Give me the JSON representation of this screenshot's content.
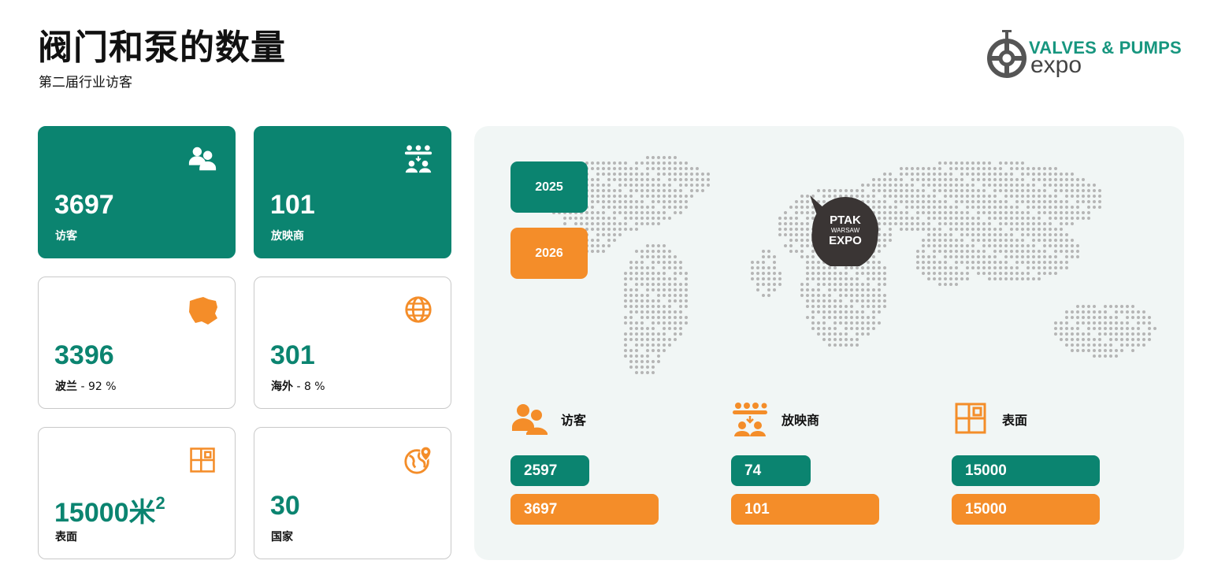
{
  "header": {
    "title": "阀门和泵的数量",
    "subtitle": "第二届行业访客"
  },
  "logo": {
    "line1": "VALVES & PUMPS",
    "line2": "expo"
  },
  "cards": [
    {
      "value": "3697",
      "label": "访客",
      "icon": "visitors-icon"
    },
    {
      "value": "101",
      "label": "放映商",
      "icon": "exhibitors-icon"
    },
    {
      "value": "3396",
      "label": "波兰",
      "label_rest": " - 92 %",
      "icon": "poland-map-icon"
    },
    {
      "value": "301",
      "label": "海外",
      "label_rest": " - 8 %",
      "icon": "globe-icon"
    },
    {
      "value": "15000米",
      "value_sup": "2",
      "label": "表面",
      "icon": "floor-plan-icon"
    },
    {
      "value": "30",
      "label": "国家",
      "icon": "globe-pin-icon"
    }
  ],
  "map_panel": {
    "year_2025": "2025",
    "year_2026": "2026",
    "pin_line1": "PTAK",
    "pin_line2": "WARSAW",
    "pin_line3": "EXPO"
  },
  "comparison": [
    {
      "label": "访客",
      "value_2025": "2597",
      "value_2026": "3697",
      "icon": "visitors-icon"
    },
    {
      "label": "放映商",
      "value_2025": "74",
      "value_2026": "101",
      "icon": "exhibitors-icon"
    },
    {
      "label": "表面",
      "value_2025": "15000",
      "value_2026": "15000",
      "icon": "floor-plan-icon"
    }
  ],
  "colors": {
    "green": "#0b8470",
    "orange": "#f48d29",
    "panel_bg": "#f1f6f5",
    "map_dot": "#b5b5b5"
  }
}
